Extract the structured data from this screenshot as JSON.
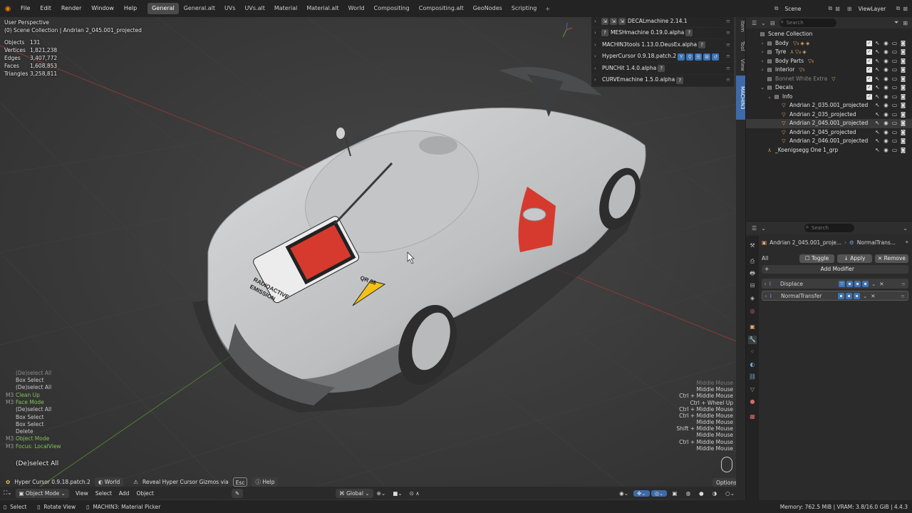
{
  "menu": [
    "File",
    "Edit",
    "Render",
    "Window",
    "Help"
  ],
  "workspaces": [
    "General",
    "General.alt",
    "UVs",
    "UVs.alt",
    "Material",
    "Material.alt",
    "World",
    "Compositing",
    "Compositing.alt",
    "GeoNodes",
    "Scripting"
  ],
  "scene": "Scene",
  "view_layer": "ViewLayer",
  "viewport": {
    "title": "User Perspective",
    "subtitle": "(0) Scene Collection | Andrian 2_045.001_projected",
    "stats": [
      {
        "k": "Objects",
        "v": "131"
      },
      {
        "k": "Vertices",
        "v": "1,821,238"
      },
      {
        "k": "Edges",
        "v": "3,407,772"
      },
      {
        "k": "Faces",
        "v": "1,608,853"
      },
      {
        "k": "Triangles",
        "v": "3,258,811"
      }
    ],
    "ops": [
      {
        "p": "",
        "t": "(De)select All",
        "c": "dim"
      },
      {
        "p": "",
        "t": "Box Select",
        "c": "w"
      },
      {
        "p": "",
        "t": "(De)select All",
        "c": "w"
      },
      {
        "p": "M3",
        "t": "Clean Up",
        "c": "g"
      },
      {
        "p": "M3",
        "t": "Face Mode",
        "c": "g"
      },
      {
        "p": "",
        "t": "(De)select All",
        "c": "w"
      },
      {
        "p": "",
        "t": "Box Select",
        "c": "w"
      },
      {
        "p": "",
        "t": "Box Select",
        "c": "w"
      },
      {
        "p": "",
        "t": "Delete",
        "c": "w"
      },
      {
        "p": "M3",
        "t": "Object Mode",
        "c": "g"
      },
      {
        "p": "M3",
        "t": "Focus: LocalView",
        "c": "g"
      }
    ],
    "last_op": "(De)select All",
    "keys": [
      "Middle Mouse",
      "Middle Mouse",
      "Ctrl + Middle Mouse",
      "Ctrl + Wheel Up",
      "Ctrl + Middle Mouse",
      "Ctrl + Middle Mouse",
      "Middle Mouse",
      "Shift + Middle Mouse",
      "Middle Mouse",
      "Ctrl + Middle Mouse",
      "Middle Mouse"
    ],
    "hc_bar": {
      "name": "Hyper Cursor 0.9.18.patch.2",
      "world": "World",
      "reveal": "Reveal Hyper Cursor Gizmos via",
      "key": "Esc",
      "help": "Help"
    },
    "options": "Options",
    "decal_text": [
      "RADIOACTIVE",
      "EMISSION"
    ],
    "decal_code": "QR 38"
  },
  "addons": [
    {
      "label": "DECALmachine 2.14.1",
      "pre": [
        "⇲",
        "⇲",
        "⇲"
      ]
    },
    {
      "label": "MESHmachine 0.19.0.alpha",
      "pre": [
        "?"
      ],
      "post": [
        "?"
      ]
    },
    {
      "label": "MACHIN3tools 1.13.0.DeusEx.alpha",
      "post": [
        "?"
      ]
    },
    {
      "label": "HyperCursor 0.9.18.patch.2",
      "post": [
        "Y",
        "⚲",
        "☰",
        "⊞",
        "↺"
      ]
    },
    {
      "label": "PUNCHit 1.4.0.alpha",
      "post": [
        "?"
      ]
    },
    {
      "label": "CURVEmachine 1.5.0.alpha",
      "post": [
        "?"
      ]
    }
  ],
  "ntabs": [
    "Item",
    "Tool",
    "View",
    "MACHIN3"
  ],
  "outliner": {
    "search_placeholder": "Search",
    "rows": [
      {
        "d": 0,
        "lbl": "Scene Collection",
        "t": "coll",
        "exp": "",
        "extra": ""
      },
      {
        "d": 1,
        "lbl": "Body",
        "t": "coll",
        "exp": "›",
        "extra": "▽₃ ◈ ◈"
      },
      {
        "d": 1,
        "lbl": "Tyre",
        "t": "coll",
        "exp": "›",
        "extra": "⅄ ▽₄ ◈"
      },
      {
        "d": 1,
        "lbl": "Body Parts",
        "t": "coll",
        "exp": "›",
        "extra": "▽₆"
      },
      {
        "d": 1,
        "lbl": "Interior",
        "t": "coll",
        "exp": "›",
        "extra": "▽₅"
      },
      {
        "d": 1,
        "lbl": "Bonnet White Extra",
        "t": "coll",
        "exp": "",
        "extra": "▽",
        "dim": true
      },
      {
        "d": 1,
        "lbl": "Decals",
        "t": "coll",
        "exp": "⌄",
        "extra": ""
      },
      {
        "d": 2,
        "lbl": "Info",
        "t": "coll",
        "exp": "⌄",
        "extra": ""
      },
      {
        "d": 3,
        "lbl": "Andrian 2_035.001_projected",
        "t": "mesh",
        "exp": "",
        "extra": ""
      },
      {
        "d": 3,
        "lbl": "Andrian 2_035_projected",
        "t": "mesh",
        "exp": "",
        "extra": ""
      },
      {
        "d": 3,
        "lbl": "Andrian 2_045.001_projected",
        "t": "mesh",
        "exp": "",
        "extra": "",
        "hl": true
      },
      {
        "d": 3,
        "lbl": "Andrian 2_045_projected",
        "t": "mesh",
        "exp": "",
        "extra": ""
      },
      {
        "d": 3,
        "lbl": "Andrian 2_046.001_projected",
        "t": "mesh",
        "exp": "",
        "extra": ""
      },
      {
        "d": 1,
        "lbl": "_Koenigsegg One 1_grp",
        "t": "empty",
        "exp": "",
        "extra": ""
      }
    ]
  },
  "props": {
    "search_placeholder": "Search",
    "object": "Andrian 2_045.001_proje...",
    "modifier": "NormalTrans...",
    "all": "All",
    "toggle": "Toggle",
    "apply": "Apply",
    "remove": "Remove",
    "add": "Add Modifier",
    "modifiers": [
      "Displace",
      "NormalTransfer"
    ]
  },
  "header": {
    "mode": "Object Mode",
    "menus": [
      "View",
      "Select",
      "Add",
      "Object"
    ],
    "orient": "Global"
  },
  "status": {
    "select": "Select",
    "rotate": "Rotate View",
    "picker": "MACHIN3: Material Picker",
    "memory": "Memory: 762.5 MiB | VRAM: 3.8/16.0 GiB | 4.4.3"
  },
  "colors": {
    "accent": "#3d6aa8",
    "green": "#7ec45a",
    "orange": "#e9a867",
    "car": "#c9cbcd",
    "background": "#3a3a3a"
  }
}
